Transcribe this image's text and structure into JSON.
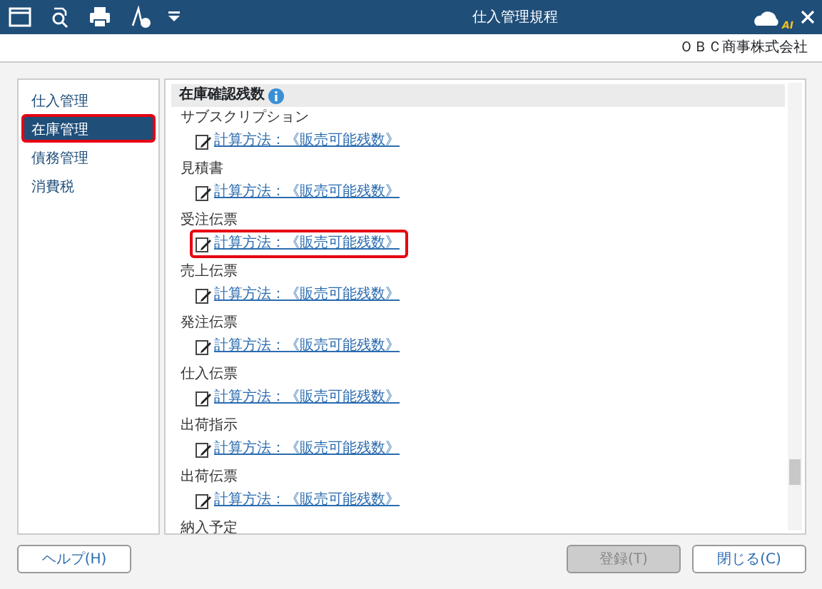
{
  "window": {
    "title": "仕入管理規程",
    "ai_badge": "AI",
    "company": "ＯＢＣ商事株式会社"
  },
  "sidebar": {
    "items": [
      {
        "label": "仕入管理",
        "selected": false,
        "highlighted": false
      },
      {
        "label": "在庫管理",
        "selected": true,
        "highlighted": true
      },
      {
        "label": "債務管理",
        "selected": false,
        "highlighted": false
      },
      {
        "label": "消費税",
        "selected": false,
        "highlighted": false
      }
    ]
  },
  "section": {
    "title": "在庫確認残数",
    "items": [
      {
        "label": "サブスクリプション",
        "link": "計算方法：《販売可能残数》",
        "highlighted": false
      },
      {
        "label": "見積書",
        "link": "計算方法：《販売可能残数》",
        "highlighted": false
      },
      {
        "label": "受注伝票",
        "link": "計算方法：《販売可能残数》",
        "highlighted": true
      },
      {
        "label": "売上伝票",
        "link": "計算方法：《販売可能残数》",
        "highlighted": false
      },
      {
        "label": "発注伝票",
        "link": "計算方法：《販売可能残数》",
        "highlighted": false
      },
      {
        "label": "仕入伝票",
        "link": "計算方法：《販売可能残数》",
        "highlighted": false
      },
      {
        "label": "出荷指示",
        "link": "計算方法：《販売可能残数》",
        "highlighted": false
      },
      {
        "label": "出荷伝票",
        "link": "計算方法：《販売可能残数》",
        "highlighted": false
      },
      {
        "label": "納入予定"
      }
    ]
  },
  "buttons": [
    {
      "label": "ヘルプ(H)",
      "disabled": false
    },
    {
      "label": "登録(T)",
      "disabled": true
    },
    {
      "label": "閉じる(C)",
      "disabled": false
    }
  ]
}
